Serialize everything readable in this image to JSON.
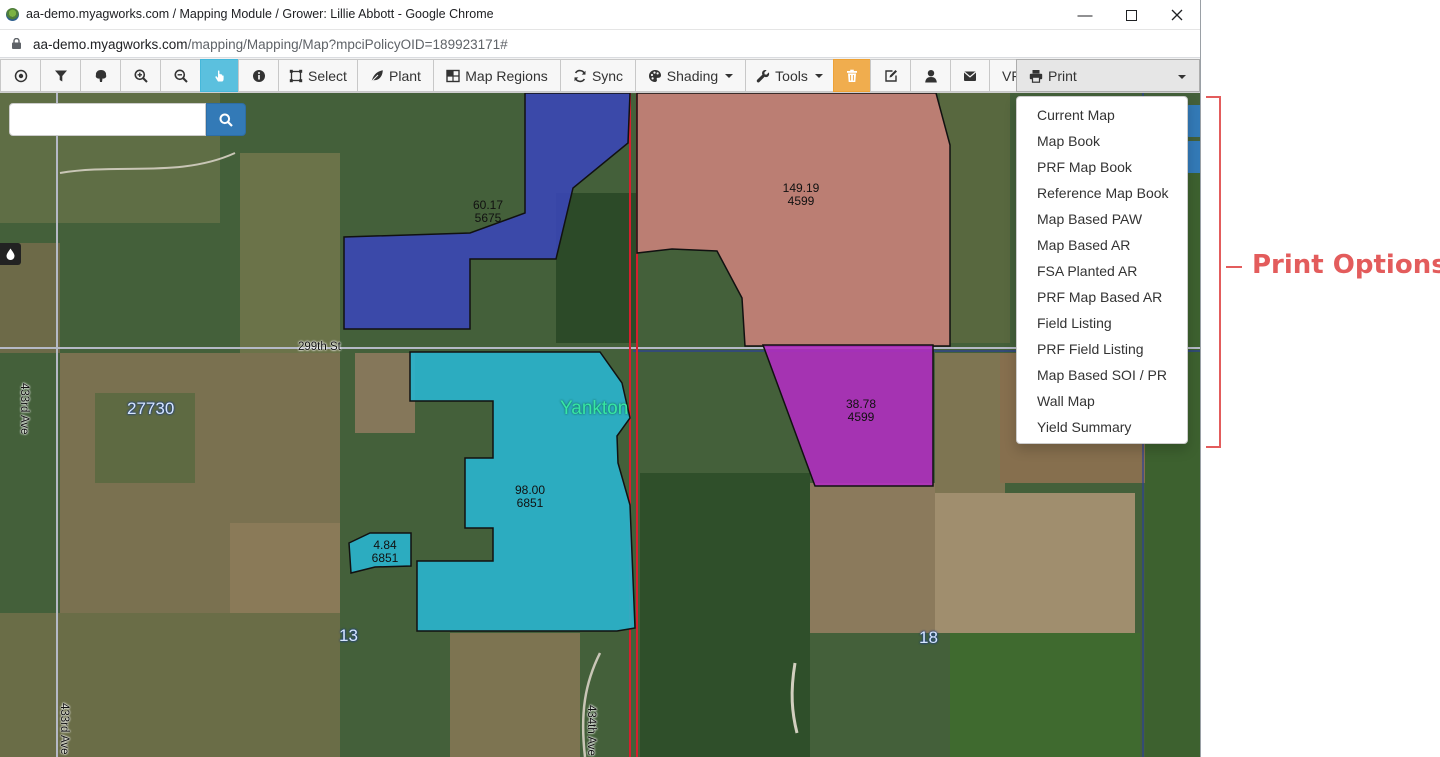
{
  "window": {
    "title": "aa-demo.myagworks.com / Mapping Module / Grower: Lillie Abbott - Google Chrome",
    "url_host": "aa-demo.myagworks.com",
    "url_path": "/mapping/Mapping/Map?mpciPolicyOID=189923171#"
  },
  "toolbar": {
    "select_label": "Select",
    "plant_label": "Plant",
    "map_regions_label": "Map Regions",
    "sync_label": "Sync",
    "shading_label": "Shading",
    "tools_label": "Tools",
    "vf_label": "VF",
    "print_label": "Print"
  },
  "search": {
    "placeholder": ""
  },
  "print_menu": {
    "items": [
      "Current Map",
      "Map Book",
      "PRF Map Book",
      "Reference Map Book",
      "Map Based PAW",
      "Map Based AR",
      "FSA Planted AR",
      "PRF Map Based AR",
      "Field Listing",
      "PRF Field Listing",
      "Map Based SOI / PR",
      "Wall Map",
      "Yield Summary"
    ]
  },
  "fields": [
    {
      "acres": "60.17",
      "code": "5675",
      "color": "#3a45b8"
    },
    {
      "acres": "149.19",
      "code": "4599",
      "color": "#c9827a"
    },
    {
      "acres": "38.78",
      "code": "4599",
      "color": "#b02fc0"
    },
    {
      "acres": "98.00",
      "code": "6851",
      "color": "#2ab3cc"
    },
    {
      "acres": "4.84",
      "code": "6851",
      "color": "#2ab3cc"
    }
  ],
  "map": {
    "county": "Yankton",
    "sections": [
      "27730",
      "13",
      "18"
    ],
    "roads": [
      "299th St",
      "433rd Ave",
      "433rd Ave",
      "434th Ave"
    ]
  },
  "annotation": {
    "text": "Print Options",
    "color": "#e35c5c"
  }
}
